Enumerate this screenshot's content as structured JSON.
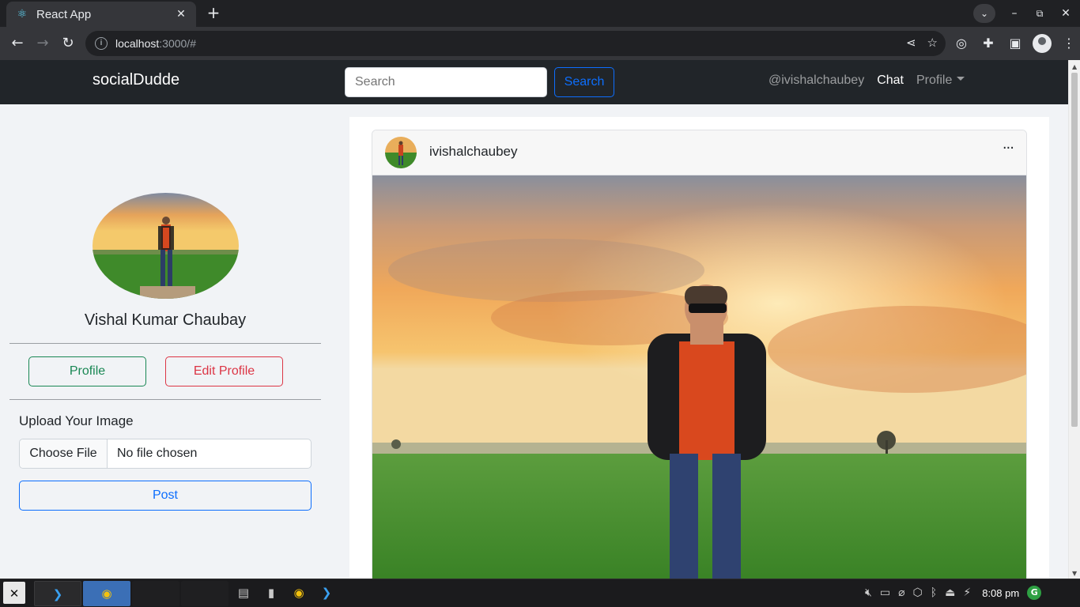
{
  "browser": {
    "tab_title": "React App",
    "url_host": "localhost",
    "url_path": ":3000/#",
    "colors": {
      "frame": "#202124",
      "toolbar": "#35363a"
    }
  },
  "nav": {
    "brand": "socialDudde",
    "search_placeholder": "Search",
    "search_button": "Search",
    "handle": "@ivishalchaubey",
    "chat": "Chat",
    "profile": "Profile"
  },
  "sidebar": {
    "name": "Vishal Kumar Chaubay",
    "profile_button": "Profile",
    "edit_button": "Edit Profile",
    "upload_label": "Upload Your Image",
    "choose_file": "Choose File",
    "no_file": "No file chosen",
    "post_button": "Post"
  },
  "post": {
    "username": "ivishalchaubey",
    "more": "···"
  },
  "taskbar": {
    "clock": "8:08 pm",
    "update_badge": "G"
  },
  "icons": {
    "back": "arrow-left-icon",
    "forward": "arrow-right-icon",
    "reload": "reload-icon",
    "share": "share-icon",
    "star": "star-icon",
    "extensions": "puzzle-icon"
  }
}
